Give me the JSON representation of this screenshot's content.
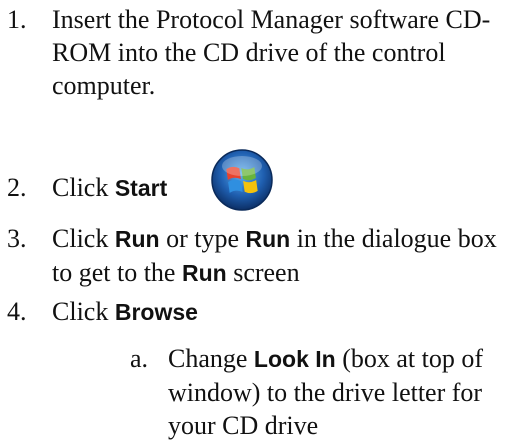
{
  "steps": [
    {
      "num": "1.",
      "text": "Insert the Protocol Manager software CD-ROM into the CD drive of the control computer."
    },
    {
      "num": "2.",
      "pre": "Click ",
      "bold": "Start"
    },
    {
      "num": "3.",
      "pre": "Click ",
      "bold1": "Run",
      "mid1": " or type ",
      "bold2": "Run",
      "mid2": " in the dialogue box to get to the ",
      "bold3": "Run",
      "post": " screen"
    },
    {
      "num": "4.",
      "pre": "Click ",
      "bold": "Browse"
    }
  ],
  "substeps": [
    {
      "letter": "a.",
      "pre": "Change ",
      "bold": "Look In",
      "post": " (box at top of window) to the drive letter for your CD drive"
    }
  ],
  "icons": {
    "start": "windows-start-orb-icon"
  },
  "colors": {
    "orb_blue": "#1f5fb0",
    "logo_red": "#e8432e",
    "logo_green": "#69b43c",
    "logo_blue": "#2f8fe0",
    "logo_yellow": "#f4c20d"
  }
}
